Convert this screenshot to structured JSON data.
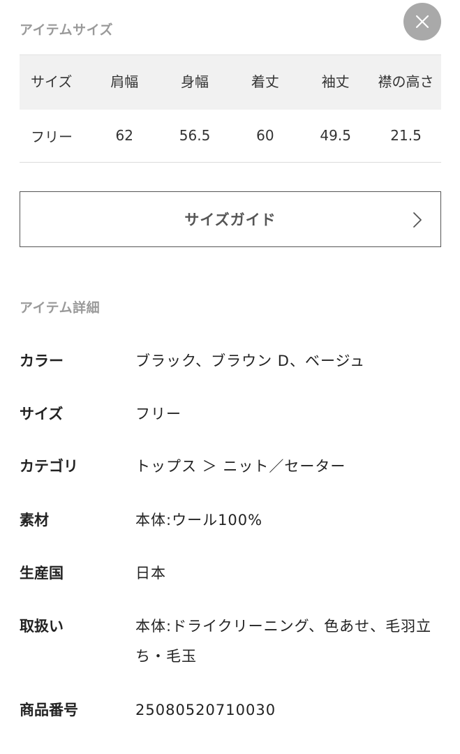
{
  "close_button": {
    "icon": "close-icon"
  },
  "item_size": {
    "title": "アイテムサイズ",
    "headers": [
      "サイズ",
      "肩幅",
      "身幅",
      "着丈",
      "袖丈",
      "襟の高さ"
    ],
    "rows": [
      [
        "フリー",
        "62",
        "56.5",
        "60",
        "49.5",
        "21.5"
      ]
    ]
  },
  "size_guide": {
    "label": "サイズガイド",
    "icon": "chevron-right-icon"
  },
  "item_details": {
    "title": "アイテム詳細",
    "rows": [
      {
        "key": "カラー",
        "value": "ブラック、ブラウン D、ベージュ"
      },
      {
        "key": "サイズ",
        "value": "フリー"
      },
      {
        "key": "カテゴリ",
        "value": "トップス ＞ ニット／セーター"
      },
      {
        "key": "素材",
        "value": "本体:ウール100%"
      },
      {
        "key": "生産国",
        "value": "日本"
      },
      {
        "key": "取扱い",
        "value": "本体:ドライクリーニング、色あせ、毛羽立ち・毛玉"
      },
      {
        "key": "商品番号",
        "value": "25080520710030"
      }
    ]
  }
}
